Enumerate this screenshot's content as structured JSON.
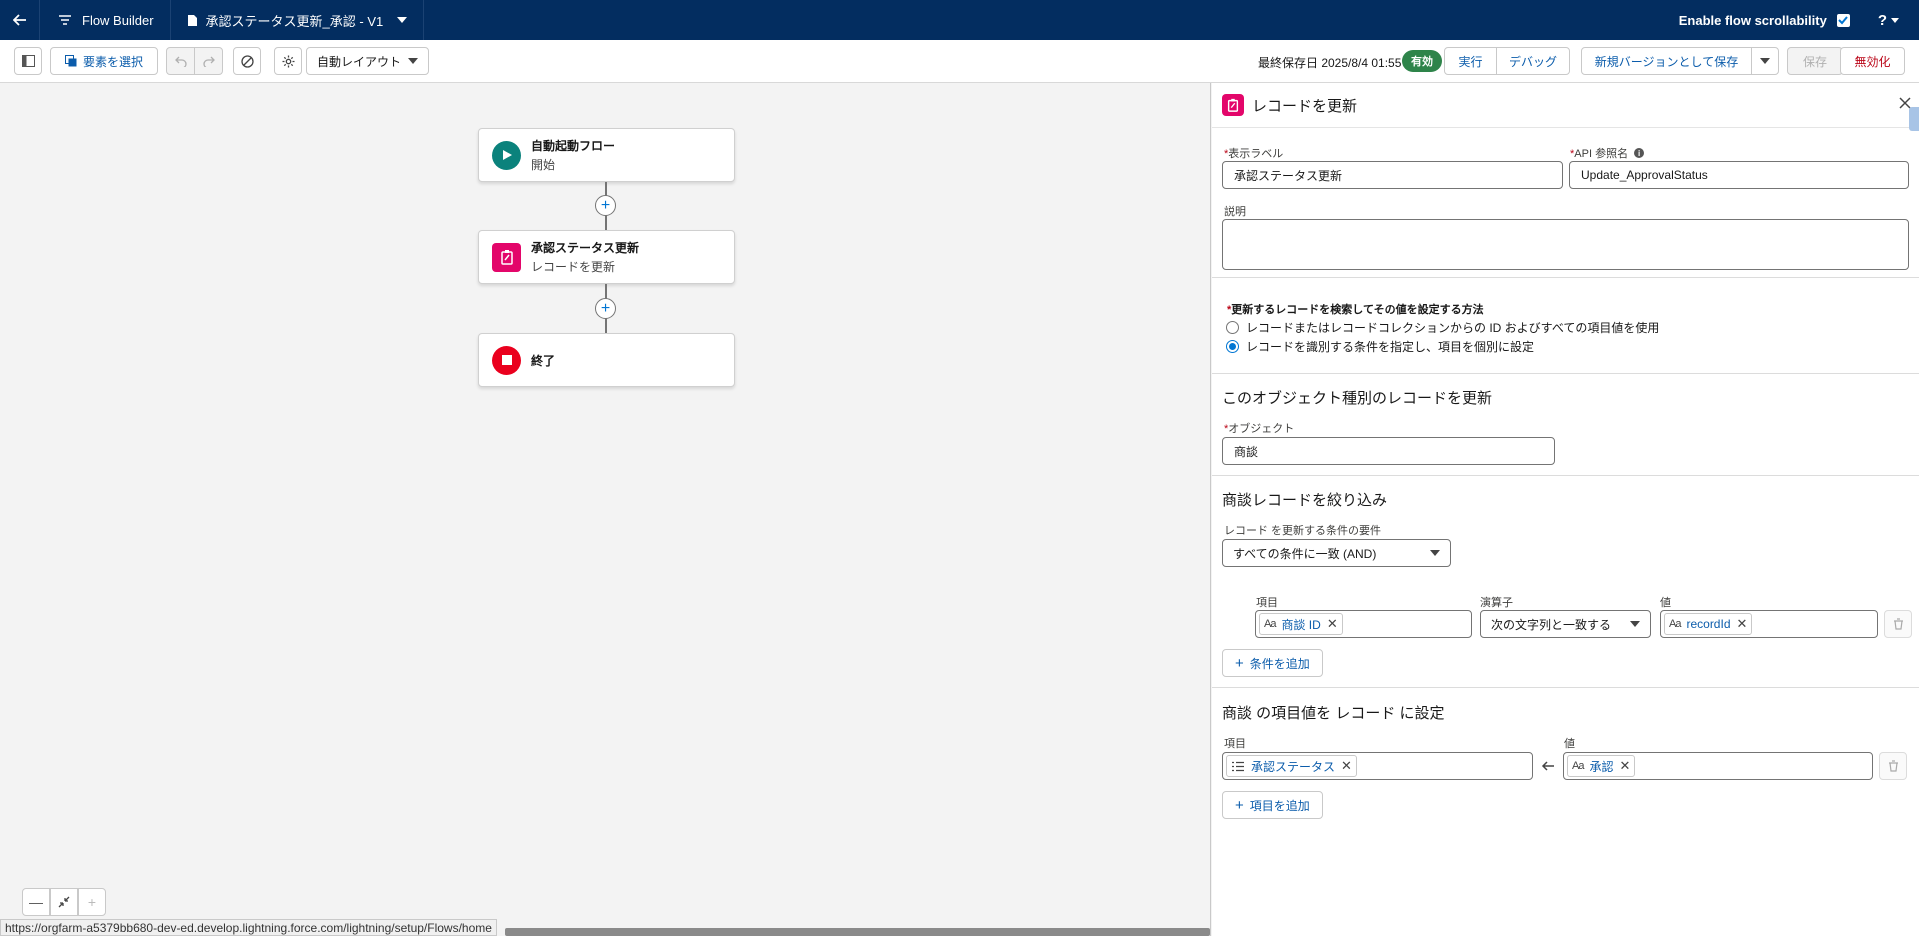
{
  "topbar": {
    "app_name": "Flow Builder",
    "flow_name": "承認ステータス更新_承認 - V1",
    "scroll_label": "Enable flow scrollability",
    "help_label": "?"
  },
  "toolbar": {
    "select_elements": "要素を選択",
    "layout_select": "自動レイアウト",
    "last_saved": "最終保存日 2025/8/4 01:55",
    "status_badge": "有効",
    "run": "実行",
    "debug": "デバッグ",
    "save_as_new_version": "新規バージョンとして保存",
    "save": "保存",
    "deactivate": "無効化"
  },
  "canvas": {
    "nodes": [
      {
        "title": "自動起動フロー",
        "subtitle": "開始"
      },
      {
        "title": "承認ステータス更新",
        "subtitle": "レコードを更新"
      },
      {
        "title": "終了",
        "subtitle": ""
      }
    ],
    "status_url": "https://orgfarm-a5379bb680-dev-ed.develop.lightning.force.com/lightning/setup/Flows/home"
  },
  "panel": {
    "title": "レコードを更新",
    "label_field": {
      "label": "表示ラベル",
      "value": "承認ステータス更新"
    },
    "api_field": {
      "label": "API 参照名",
      "value": "Update_ApprovalStatus"
    },
    "description_label": "説明",
    "method": {
      "label": "更新するレコードを検索してその値を設定する方法",
      "option1": "レコードまたはレコードコレクションからの ID およびすべての項目値を使用",
      "option2": "レコードを識別する条件を指定し、項目を個別に設定"
    },
    "object_section": {
      "title": "このオブジェクト種別のレコードを更新",
      "object_label": "オブジェクト",
      "object_value": "商談"
    },
    "filter_section": {
      "title": "商談レコードを絞り込み",
      "requirement_label": "レコード を更新する条件の要件",
      "requirement_value": "すべての条件に一致 (AND)",
      "col_field": "項目",
      "col_operator": "演算子",
      "col_value": "値",
      "row": {
        "field": "商談 ID",
        "operator": "次の文字列と一致する",
        "value": "recordId"
      },
      "add_condition": "条件を追加"
    },
    "set_section": {
      "title": "商談 の項目値を レコード に設定",
      "col_field": "項目",
      "col_value": "値",
      "row": {
        "field": "承認ステータス",
        "value": "承認"
      },
      "add_field": "項目を追加"
    },
    "text_type_icon": "Aa"
  }
}
